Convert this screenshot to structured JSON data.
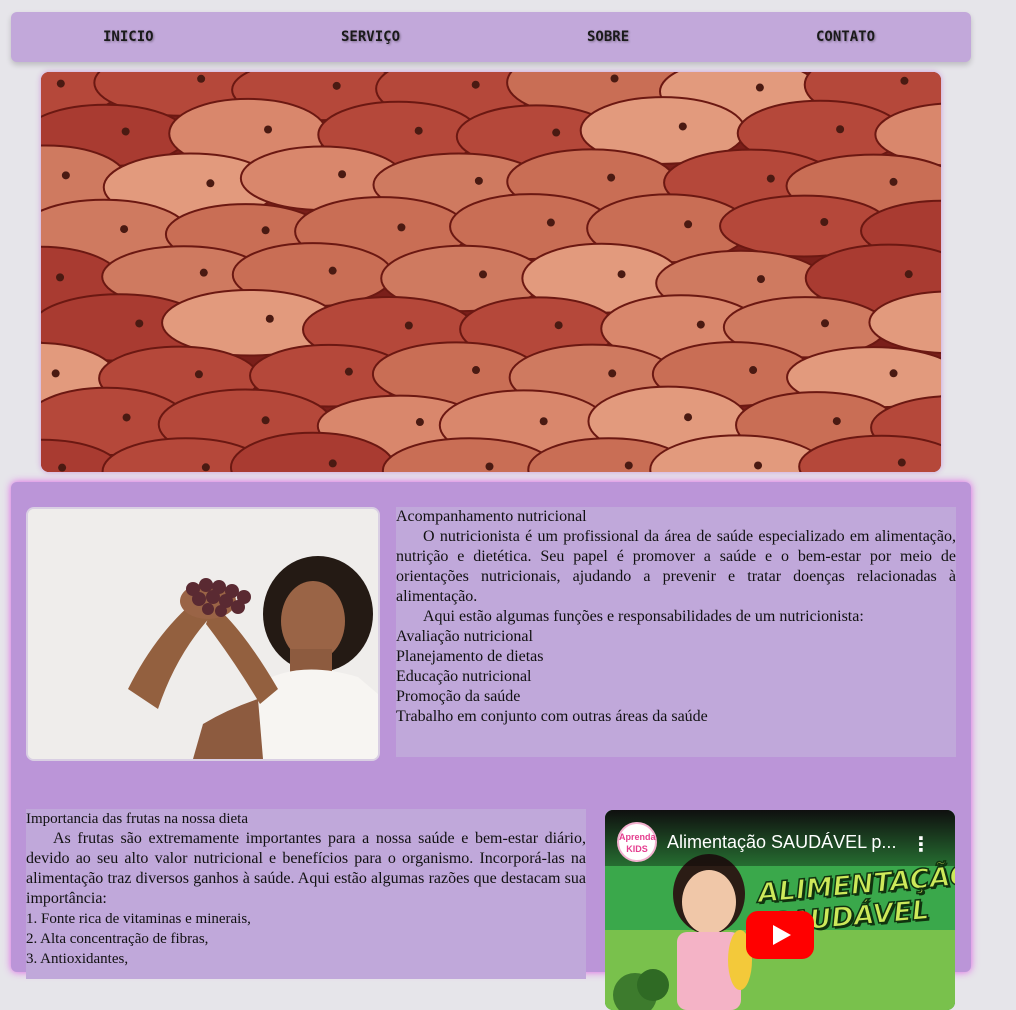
{
  "nav": {
    "items": [
      {
        "label": "INICIO"
      },
      {
        "label": "SERVIÇO"
      },
      {
        "label": "SOBRE"
      },
      {
        "label": "CONTATO"
      }
    ]
  },
  "hero": {
    "image": "apples-photo"
  },
  "section1": {
    "image": "woman-with-grapes-photo",
    "title": "Acompanhamento nutricional",
    "paragraph1": "O nutricionista é um profissional da área de saúde especializado em alimentação, nutrição e dietética. Seu papel é promover a saúde e o bem-estar por meio de orientações nutricionais, ajudando a prevenir e tratar doenças relacionadas à alimentação.",
    "paragraph2": "Aqui estão algumas funções e responsabilidades de um nutricionista:",
    "functions": [
      "Avaliação nutricional",
      "Planejamento de dietas",
      "Educação nutricional",
      "Promoção da saúde",
      "Trabalho em conjunto com outras áreas da saúde"
    ]
  },
  "section2": {
    "title": "Importancia das frutas na nossa dieta",
    "paragraph1": "As frutas são extremamente importantes para a nossa saúde e bem-estar diário, devido ao seu alto valor nutricional e benefícios para o organismo. Incorporá-las na alimentação traz diversos ganhos à saúde. Aqui estão algumas razões que destacam sua importância:",
    "reasons": [
      "1. Fonte rica de vitaminas e minerais,",
      "2. Alta concentração de fibras,",
      "3. Antioxidantes,"
    ]
  },
  "video": {
    "channel_badge": "Aprenda KIDS",
    "title": "Alimentação SAUDÁVEL p...",
    "thumbnail_text_1": "ALIMENTAÇÃO",
    "thumbnail_text_2": "SAUDÁVEL",
    "menu_icon": "more-vert-icon",
    "play_icon": "youtube-play-icon"
  },
  "colors": {
    "nav_bg": "#c2a8da",
    "content_bg": "#bb95d8",
    "text_bg": "#c0a8da",
    "glow": "#dc3ce6"
  }
}
